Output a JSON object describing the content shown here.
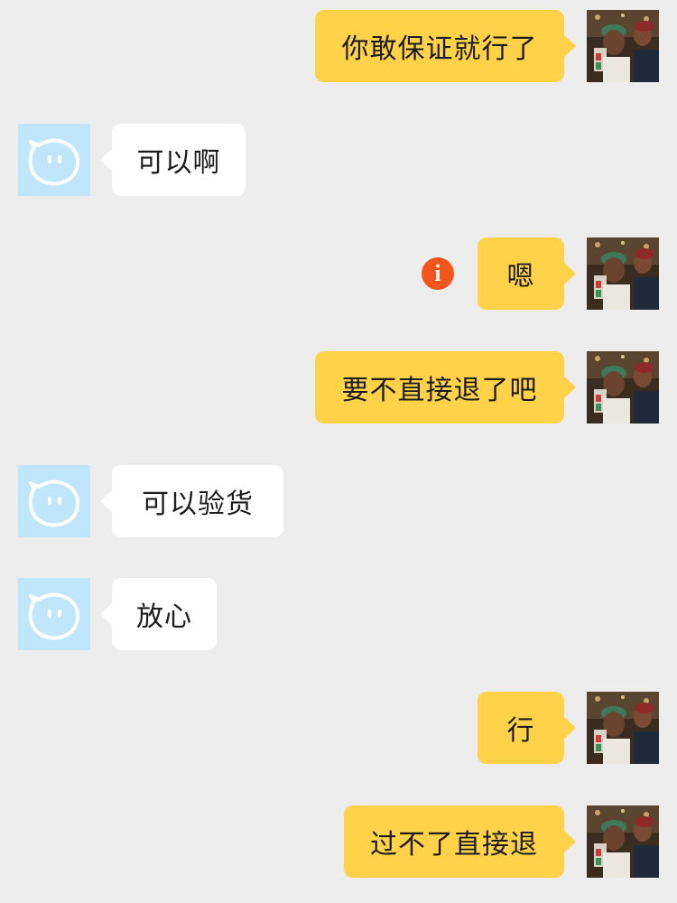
{
  "messages": [
    {
      "side": "right",
      "text": "你敢保证就行了"
    },
    {
      "side": "left",
      "text": "可以啊"
    },
    {
      "side": "right",
      "text": "嗯",
      "status_icon": "send-failed-icon",
      "status_glyph": "i"
    },
    {
      "side": "right",
      "text": "要不直接退了吧"
    },
    {
      "side": "left",
      "text": "可以验货"
    },
    {
      "side": "left",
      "text": "放心"
    },
    {
      "side": "right",
      "text": "行"
    },
    {
      "side": "right",
      "text": "过不了直接退"
    }
  ],
  "colors": {
    "background": "#ededed",
    "outgoing_bubble": "#ffd24a",
    "incoming_bubble": "#ffffff",
    "bot_avatar_bg": "#bfe6fb",
    "failed_icon": "#f2561d"
  },
  "icons": {
    "bot_avatar": "chat-bot-face-icon",
    "user_avatar": "user-photo-avatar"
  }
}
